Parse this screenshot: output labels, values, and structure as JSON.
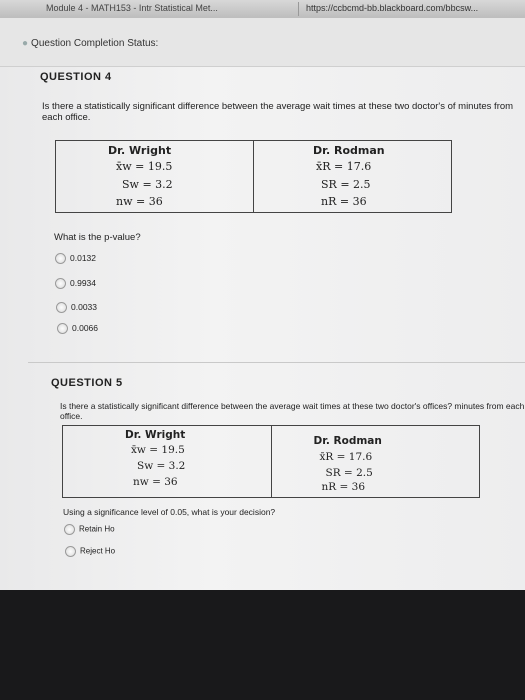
{
  "browser": {
    "tab_title": "Module 4 - MATH153 - Intr Statistical Met...",
    "url": "https://ccbcmd-bb.blackboard.com/bbcsw..."
  },
  "status": {
    "label": "Question Completion Status:"
  },
  "questions": [
    {
      "title": "QUESTION 4",
      "text": "Is there a statistically significant difference between the average wait times at these two doctor's of minutes from each office.",
      "table": {
        "left": {
          "header": "Dr. Wright",
          "mean": "x̄w = 19.5",
          "sd": "Sw = 3.2",
          "n": "nw = 36"
        },
        "right": {
          "header": "Dr. Rodman",
          "mean": "x̄R = 17.6",
          "sd": "SR = 2.5",
          "n": "nR = 36"
        }
      },
      "prompt": "What is the p-value?",
      "options": [
        "0.0132",
        "0.9934",
        "0.0033",
        "0.0066"
      ]
    },
    {
      "title": "QUESTION 5",
      "text": "Is there a statistically significant difference between the average wait times at these two doctor's offices? minutes from each office.",
      "table": {
        "left": {
          "header": "Dr. Wright",
          "mean": "x̄w = 19.5",
          "sd": "Sw = 3.2",
          "n": "nw = 36"
        },
        "right": {
          "header": "Dr. Rodman",
          "mean": "x̄R = 17.6",
          "sd": "SR = 2.5",
          "n": "nR = 36"
        }
      },
      "prompt": "Using a significance level of 0.05, what is your decision?",
      "options": [
        "Retain Ho",
        "Reject Ho"
      ]
    }
  ]
}
